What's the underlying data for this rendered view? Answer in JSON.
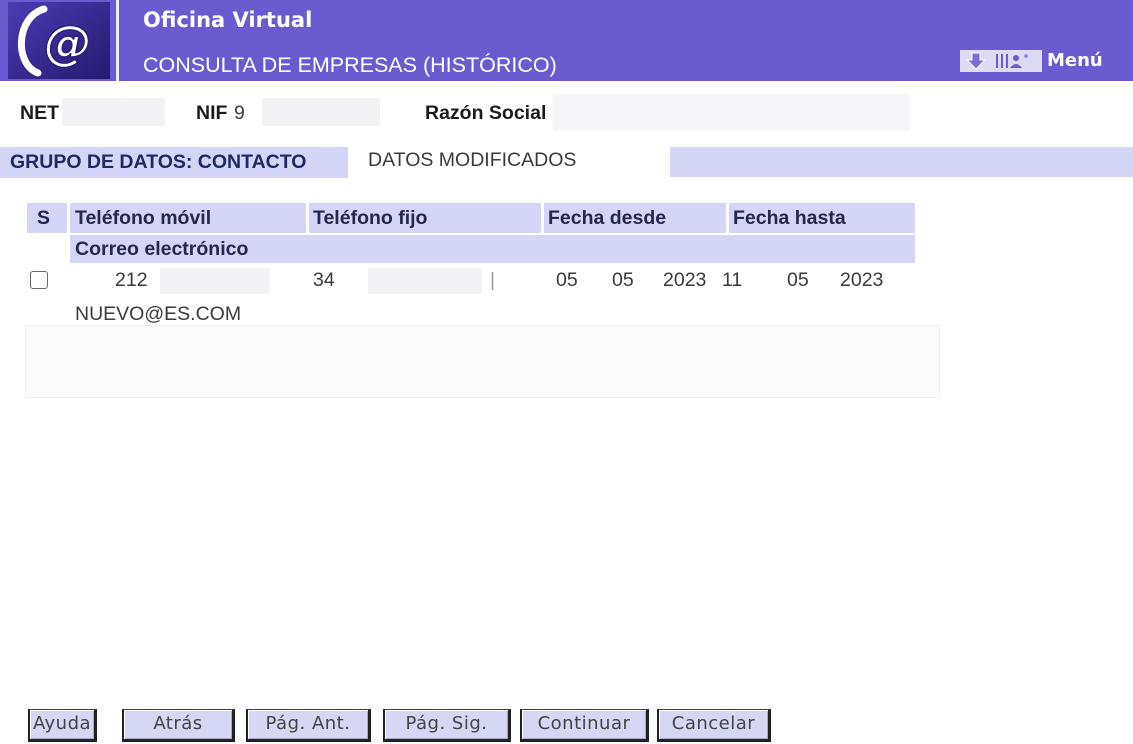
{
  "theme": {
    "header_bar": "#6a5bd0",
    "accent": "#d4d5f7",
    "heading_text": "#1f2a63"
  },
  "header": {
    "logo_text": "@",
    "app_title": "Oficina Virtual",
    "page_title": "CONSULTA DE EMPRESAS (HISTÓRICO)",
    "menu_icons": [
      "down-arrow-icon",
      "user-columns-icon"
    ],
    "menu_label": "Menú"
  },
  "company": {
    "net_label": "NET",
    "nif_label": "NIF",
    "nif_value": "9",
    "razon_social_label": "Razón Social"
  },
  "group": {
    "label": "GRUPO DE DATOS: CONTACTO",
    "status": "DATOS MODIFICADOS"
  },
  "table": {
    "columns": {
      "select": "S",
      "mobile": "Teléfono móvil",
      "landline": "Teléfono fijo",
      "date_from": "Fecha desde",
      "date_to": "Fecha hasta",
      "email": "Correo electrónico"
    },
    "rows": [
      {
        "selected": false,
        "mobile": "212",
        "landline": "34",
        "landline_tail": "|",
        "date_from": {
          "day": "05",
          "month": "05",
          "year": "2023"
        },
        "date_to": {
          "day": "11",
          "month": "05",
          "year": "2023"
        },
        "email": "NUEVO@ES.COM"
      }
    ]
  },
  "buttons": {
    "help": "Ayuda",
    "back": "Atrás",
    "prev_page": "Pág. Ant.",
    "next_page": "Pág. Sig.",
    "continue": "Continuar",
    "cancel": "Cancelar"
  }
}
